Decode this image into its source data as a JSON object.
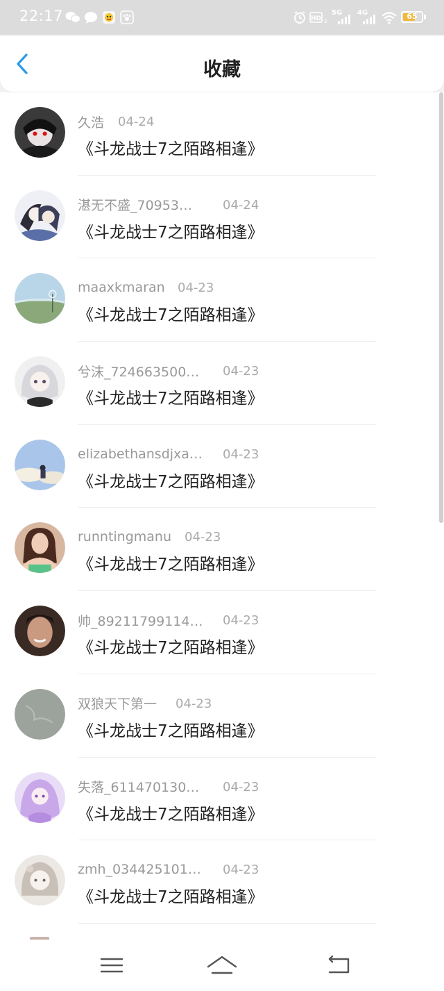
{
  "status_bar": {
    "time": "22:17",
    "icons": [
      "wechat-icon",
      "message-icon",
      "app-badge-icon",
      "paw-icon",
      "alarm-icon",
      "hd-icon",
      "5g-signal-icon",
      "4g-signal-icon",
      "wifi-icon"
    ],
    "net_5g": "5G",
    "net_4g": "4G",
    "hd": "HD",
    "battery": 65,
    "battery_label": "65"
  },
  "header": {
    "title": "收藏",
    "back_icon": "chevron-left-icon"
  },
  "colors": {
    "accent": "#2a9ae6",
    "status_bar_bg": "#dcdcdc",
    "battery": "#f1b93a"
  },
  "favorites": [
    {
      "user": "久浩",
      "date": "04-24",
      "title": "《斗龙战士7之陌路相逢》",
      "avatar": "dark-anime-avatar"
    },
    {
      "user": "湛无不盛_70953…",
      "date": "04-24",
      "title": "《斗龙战士7之陌路相逢》",
      "avatar": "anime-duo-avatar"
    },
    {
      "user": "maaxkmaran",
      "date": "04-23",
      "title": "《斗龙战士7之陌路相逢》",
      "avatar": "landscape-avatar"
    },
    {
      "user": "兮沫_724663500…",
      "date": "04-23",
      "title": "《斗龙战士7之陌路相逢》",
      "avatar": "anime-girl-avatar"
    },
    {
      "user": "elizabethansdjxa…",
      "date": "04-23",
      "title": "《斗龙战士7之陌路相逢》",
      "avatar": "sky-avatar"
    },
    {
      "user": "runntingmanu",
      "date": "04-23",
      "title": "《斗龙战士7之陌路相逢》",
      "avatar": "woman-photo-avatar"
    },
    {
      "user": "帅_89211799114…",
      "date": "04-23",
      "title": "《斗龙战士7之陌路相逢》",
      "avatar": "man-photo-avatar"
    },
    {
      "user": "双狼天下第一",
      "date": "04-23",
      "title": "《斗龙战士7之陌路相逢》",
      "avatar": "gray-avatar"
    },
    {
      "user": "失落_611470130…",
      "date": "04-23",
      "title": "《斗龙战士7之陌路相逢》",
      "avatar": "purple-anime-avatar"
    },
    {
      "user": "zmh_034425101…",
      "date": "04-23",
      "title": "《斗龙战士7之陌路相逢》",
      "avatar": "sketch-anime-avatar"
    }
  ],
  "nav_bar": {
    "menu_icon": "menu-icon",
    "home_icon": "home-icon",
    "back_icon": "return-icon"
  }
}
